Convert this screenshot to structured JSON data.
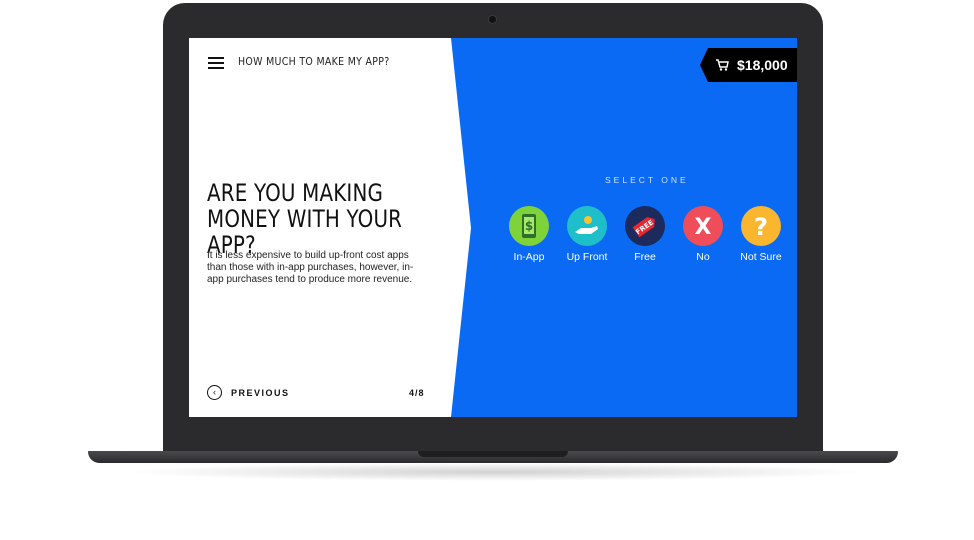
{
  "header": {
    "title": "HOW MUCH TO MAKE MY APP?"
  },
  "cart": {
    "price": "$18,000"
  },
  "question": {
    "heading": "ARE YOU MAKING MONEY WITH YOUR APP?",
    "description": "It is less expensive to build up-front cost apps than those with in-app purchases, however, in-app purchases tend to produce more revenue."
  },
  "nav": {
    "previous_label": "PREVIOUS",
    "progress": "4/8"
  },
  "select_prompt": "SELECT ONE",
  "options": [
    {
      "label": "In-App",
      "color": "#7ed33b",
      "icon": "phone-dollar-icon"
    },
    {
      "label": "Up Front",
      "color": "#1fbfc9",
      "icon": "hand-coin-icon"
    },
    {
      "label": "Free",
      "color": "#1d2a5c",
      "icon": "free-tag-icon",
      "tag_text": "FREE"
    },
    {
      "label": "No",
      "color": "#ef4d5a",
      "icon": "x-icon",
      "glyph": "X"
    },
    {
      "label": "Not Sure",
      "color": "#fbb62f",
      "icon": "question-icon",
      "glyph": "?"
    }
  ]
}
